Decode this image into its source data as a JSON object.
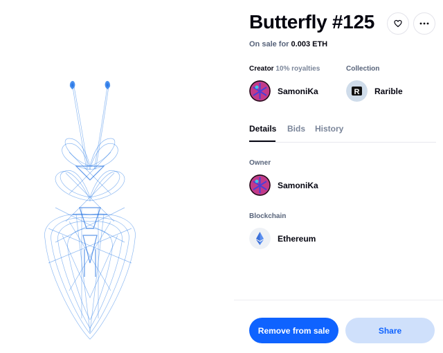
{
  "item": {
    "title": "Butterfly #125",
    "sale_prefix": "On sale for",
    "price": "0.003 ETH"
  },
  "creator": {
    "label": "Creator",
    "royalties": "10% royalties",
    "name": "SamoniKa"
  },
  "collection": {
    "label": "Collection",
    "name": "Rarible",
    "logo_letter": "R"
  },
  "tabs": [
    {
      "label": "Details",
      "active": true
    },
    {
      "label": "Bids",
      "active": false
    },
    {
      "label": "History",
      "active": false
    }
  ],
  "owner": {
    "label": "Owner",
    "name": "SamoniKa"
  },
  "blockchain": {
    "label": "Blockchain",
    "name": "Ethereum"
  },
  "actions": {
    "remove_label": "Remove from sale",
    "share_label": "Share"
  },
  "icons": {
    "like": "heart-icon",
    "more": "more-horizontal-icon",
    "chain": "ethereum-icon"
  },
  "colors": {
    "accent": "#0f63ff",
    "accent_light": "#cfe0fb",
    "artwork_line": "#2f7fe8"
  }
}
